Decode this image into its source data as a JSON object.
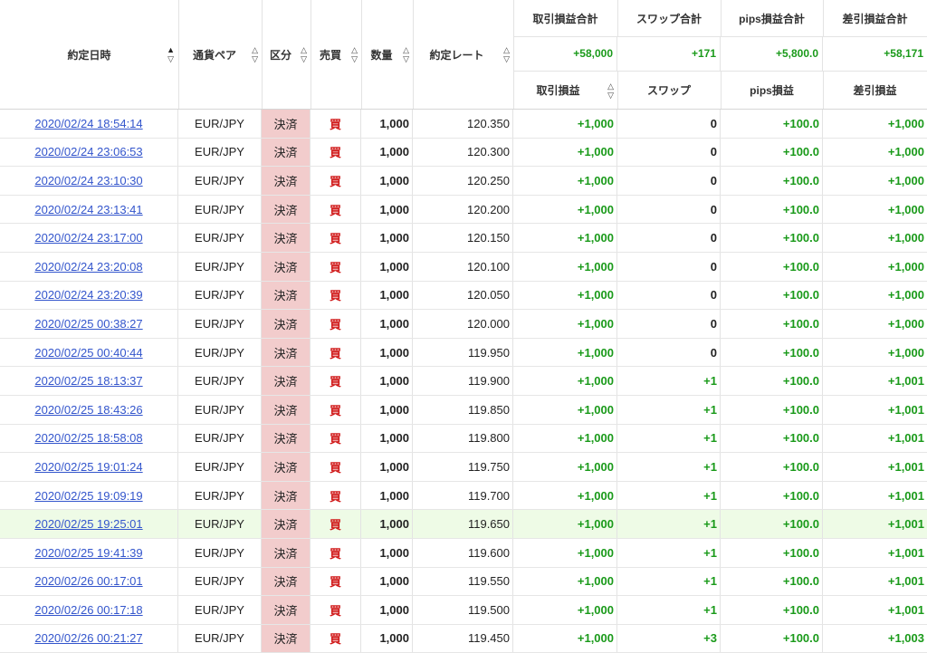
{
  "colors": {
    "positive": "#1a9a1a",
    "buy": "#d01818",
    "link": "#3355cc",
    "kubun_bg": "#f2cccc",
    "highlight_row": "#eefbe6"
  },
  "header": {
    "datetime": "約定日時",
    "pair": "通貨ペア",
    "kubun": "区分",
    "side": "売買",
    "qty": "数量",
    "rate": "約定レート",
    "sum_labels": {
      "trade_pl": "取引損益合計",
      "swap": "スワップ合計",
      "pips": "pips損益合計",
      "net": "差引損益合計"
    },
    "sum_values": {
      "trade_pl": "+58,000",
      "swap": "+171",
      "pips": "+5,800.0",
      "net": "+58,171"
    },
    "col_labels": {
      "trade_pl": "取引損益",
      "swap": "スワップ",
      "pips": "pips損益",
      "net": "差引損益"
    },
    "sort_up": "▲",
    "sort_down": "▽",
    "sort_up_off": "△"
  },
  "rows": [
    {
      "datetime": "2020/02/24 18:54:14",
      "pair": "EUR/JPY",
      "kubun": "決済",
      "side": "買",
      "qty": "1,000",
      "rate": "120.350",
      "trade_pl": "+1,000",
      "swap": "0",
      "pips": "+100.0",
      "net": "+1,000"
    },
    {
      "datetime": "2020/02/24 23:06:53",
      "pair": "EUR/JPY",
      "kubun": "決済",
      "side": "買",
      "qty": "1,000",
      "rate": "120.300",
      "trade_pl": "+1,000",
      "swap": "0",
      "pips": "+100.0",
      "net": "+1,000"
    },
    {
      "datetime": "2020/02/24 23:10:30",
      "pair": "EUR/JPY",
      "kubun": "決済",
      "side": "買",
      "qty": "1,000",
      "rate": "120.250",
      "trade_pl": "+1,000",
      "swap": "0",
      "pips": "+100.0",
      "net": "+1,000"
    },
    {
      "datetime": "2020/02/24 23:13:41",
      "pair": "EUR/JPY",
      "kubun": "決済",
      "side": "買",
      "qty": "1,000",
      "rate": "120.200",
      "trade_pl": "+1,000",
      "swap": "0",
      "pips": "+100.0",
      "net": "+1,000"
    },
    {
      "datetime": "2020/02/24 23:17:00",
      "pair": "EUR/JPY",
      "kubun": "決済",
      "side": "買",
      "qty": "1,000",
      "rate": "120.150",
      "trade_pl": "+1,000",
      "swap": "0",
      "pips": "+100.0",
      "net": "+1,000"
    },
    {
      "datetime": "2020/02/24 23:20:08",
      "pair": "EUR/JPY",
      "kubun": "決済",
      "side": "買",
      "qty": "1,000",
      "rate": "120.100",
      "trade_pl": "+1,000",
      "swap": "0",
      "pips": "+100.0",
      "net": "+1,000"
    },
    {
      "datetime": "2020/02/24 23:20:39",
      "pair": "EUR/JPY",
      "kubun": "決済",
      "side": "買",
      "qty": "1,000",
      "rate": "120.050",
      "trade_pl": "+1,000",
      "swap": "0",
      "pips": "+100.0",
      "net": "+1,000"
    },
    {
      "datetime": "2020/02/25 00:38:27",
      "pair": "EUR/JPY",
      "kubun": "決済",
      "side": "買",
      "qty": "1,000",
      "rate": "120.000",
      "trade_pl": "+1,000",
      "swap": "0",
      "pips": "+100.0",
      "net": "+1,000"
    },
    {
      "datetime": "2020/02/25 00:40:44",
      "pair": "EUR/JPY",
      "kubun": "決済",
      "side": "買",
      "qty": "1,000",
      "rate": "119.950",
      "trade_pl": "+1,000",
      "swap": "0",
      "pips": "+100.0",
      "net": "+1,000"
    },
    {
      "datetime": "2020/02/25 18:13:37",
      "pair": "EUR/JPY",
      "kubun": "決済",
      "side": "買",
      "qty": "1,000",
      "rate": "119.900",
      "trade_pl": "+1,000",
      "swap": "+1",
      "pips": "+100.0",
      "net": "+1,001"
    },
    {
      "datetime": "2020/02/25 18:43:26",
      "pair": "EUR/JPY",
      "kubun": "決済",
      "side": "買",
      "qty": "1,000",
      "rate": "119.850",
      "trade_pl": "+1,000",
      "swap": "+1",
      "pips": "+100.0",
      "net": "+1,001"
    },
    {
      "datetime": "2020/02/25 18:58:08",
      "pair": "EUR/JPY",
      "kubun": "決済",
      "side": "買",
      "qty": "1,000",
      "rate": "119.800",
      "trade_pl": "+1,000",
      "swap": "+1",
      "pips": "+100.0",
      "net": "+1,001"
    },
    {
      "datetime": "2020/02/25 19:01:24",
      "pair": "EUR/JPY",
      "kubun": "決済",
      "side": "買",
      "qty": "1,000",
      "rate": "119.750",
      "trade_pl": "+1,000",
      "swap": "+1",
      "pips": "+100.0",
      "net": "+1,001"
    },
    {
      "datetime": "2020/02/25 19:09:19",
      "pair": "EUR/JPY",
      "kubun": "決済",
      "side": "買",
      "qty": "1,000",
      "rate": "119.700",
      "trade_pl": "+1,000",
      "swap": "+1",
      "pips": "+100.0",
      "net": "+1,001"
    },
    {
      "datetime": "2020/02/25 19:25:01",
      "pair": "EUR/JPY",
      "kubun": "決済",
      "side": "買",
      "qty": "1,000",
      "rate": "119.650",
      "trade_pl": "+1,000",
      "swap": "+1",
      "pips": "+100.0",
      "net": "+1,001",
      "highlight": true
    },
    {
      "datetime": "2020/02/25 19:41:39",
      "pair": "EUR/JPY",
      "kubun": "決済",
      "side": "買",
      "qty": "1,000",
      "rate": "119.600",
      "trade_pl": "+1,000",
      "swap": "+1",
      "pips": "+100.0",
      "net": "+1,001"
    },
    {
      "datetime": "2020/02/26 00:17:01",
      "pair": "EUR/JPY",
      "kubun": "決済",
      "side": "買",
      "qty": "1,000",
      "rate": "119.550",
      "trade_pl": "+1,000",
      "swap": "+1",
      "pips": "+100.0",
      "net": "+1,001"
    },
    {
      "datetime": "2020/02/26 00:17:18",
      "pair": "EUR/JPY",
      "kubun": "決済",
      "side": "買",
      "qty": "1,000",
      "rate": "119.500",
      "trade_pl": "+1,000",
      "swap": "+1",
      "pips": "+100.0",
      "net": "+1,001"
    },
    {
      "datetime": "2020/02/26 00:21:27",
      "pair": "EUR/JPY",
      "kubun": "決済",
      "side": "買",
      "qty": "1,000",
      "rate": "119.450",
      "trade_pl": "+1,000",
      "swap": "+3",
      "pips": "+100.0",
      "net": "+1,003"
    }
  ]
}
